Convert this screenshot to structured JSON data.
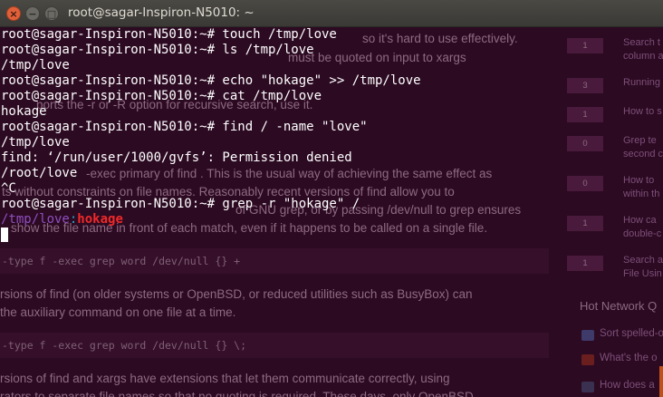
{
  "window": {
    "title": "root@sagar-Inspiron-N5010: ~",
    "close_glyph": "×",
    "minimize_glyph": "−",
    "maximize_glyph": "□"
  },
  "terminal": {
    "lines": [
      "root@sagar-Inspiron-N5010:~# touch /tmp/love",
      "root@sagar-Inspiron-N5010:~# ls /tmp/love",
      "/tmp/love",
      "root@sagar-Inspiron-N5010:~# echo \"hokage\" >> /tmp/love",
      "root@sagar-Inspiron-N5010:~# cat /tmp/love",
      "hokage",
      "root@sagar-Inspiron-N5010:~# find / -name \"love\"",
      "/tmp/love",
      "find: ‘/run/user/1000/gvfs’: Permission denied",
      "/root/love",
      "^C",
      "root@sagar-Inspiron-N5010:~# grep -r \"hokage\" /"
    ],
    "grep_result": {
      "file": "/tmp/love",
      "separator": ":",
      "match": "hokage"
    }
  },
  "background_page": {
    "paragraphs": [
      "so it's hard to use effectively.",
      "must be quoted on input to xargs",
      "ports the -r or -R option for recursive search, use it.",
      "-exec primary of find . This is the usual way of achieving the same effect as",
      "ts without constraints on file names. Reasonably recent versions of find allow you to",
      "of GNU grep, or by passing /dev/null to grep ensures",
      "show the file name in front of each match, even if it happens to be called on a single file.",
      "rsions of find (on older systems or OpenBSD, or reduced utilities such as BusyBox) can",
      "the auxiliary command on one file at a time.",
      "rsions of find and xargs have extensions that let them communicate correctly, using",
      "rators to separate file names so that no quoting is required. These days, only OpenBSD"
    ],
    "code_blocks": [
      "-type f -exec grep word /dev/null {} +",
      "-type f -exec grep word /dev/null {} \\;"
    ],
    "sidebar": {
      "items": [
        {
          "count": "1",
          "text": "Search t"
        },
        {
          "count": "",
          "text": "column a"
        },
        {
          "count": "3",
          "text": "Running"
        },
        {
          "count": "1",
          "text": "How to s"
        },
        {
          "count": "0",
          "text": "Grep te"
        },
        {
          "count": "",
          "text": "second c"
        },
        {
          "count": "0",
          "text": "How to"
        },
        {
          "count": "",
          "text": "within th"
        },
        {
          "count": "1",
          "text": "How ca"
        },
        {
          "count": "",
          "text": "double-c"
        },
        {
          "count": "1",
          "text": "Search a"
        },
        {
          "count": "",
          "text": "File Usin"
        }
      ],
      "hot_title": "Hot Network Q",
      "hot_items": [
        "Sort spelled-o",
        "What's the o",
        "How does a"
      ]
    }
  },
  "colors": {
    "terminal_bg": "#2c0a22",
    "grep_file": "#8e4fbf",
    "grep_separator": "#2aa5c8",
    "grep_match": "#ef2929"
  }
}
